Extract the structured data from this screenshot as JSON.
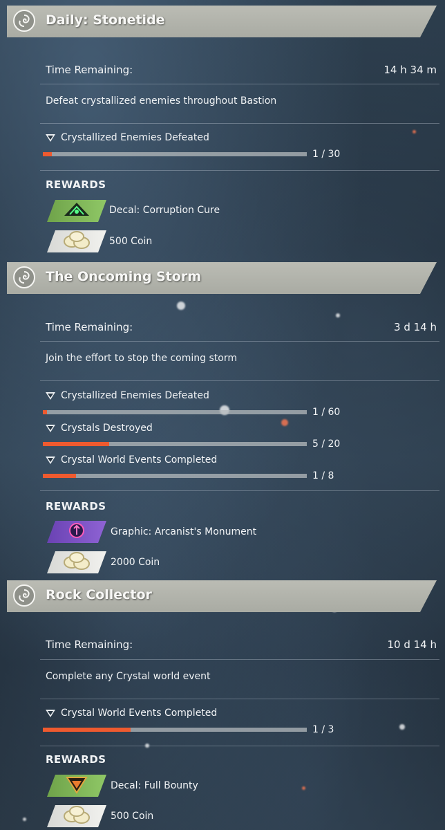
{
  "quests": [
    {
      "title": "Daily: Stonetide",
      "time_label": "Time Remaining:",
      "time_value": "14 h 34 m",
      "description": "Defeat crystallized enemies throughout Bastion",
      "objectives": [
        {
          "label": "Crystallized Enemies Defeated",
          "count": "1 / 30",
          "progress": 0.033
        }
      ],
      "rewards_heading": "REWARDS",
      "rewards": [
        {
          "label": "Decal: Corruption Cure",
          "icon": "decal-corruption-cure-icon",
          "chip_color": "#8fc766"
        },
        {
          "label": "500 Coin",
          "icon": "coins-icon",
          "chip_color": "#f1f1ee"
        }
      ]
    },
    {
      "title": "The Oncoming Storm",
      "time_label": "Time Remaining:",
      "time_value": "3 d 14 h",
      "description": "Join the effort to stop the coming storm",
      "objectives": [
        {
          "label": "Crystallized Enemies Defeated",
          "count": "1 / 60",
          "progress": 0.017
        },
        {
          "label": "Crystals Destroyed",
          "count": "5 / 20",
          "progress": 0.25
        },
        {
          "label": "Crystal World Events Completed",
          "count": "1 / 8",
          "progress": 0.125
        }
      ],
      "rewards_heading": "REWARDS",
      "rewards": [
        {
          "label": "Graphic: Arcanist's Monument",
          "icon": "graphic-arcanist-monument-icon",
          "chip_color": "#8e63d4"
        },
        {
          "label": "2000 Coin",
          "icon": "coins-icon",
          "chip_color": "#f1f1ee"
        }
      ]
    },
    {
      "title": "Rock Collector",
      "time_label": "Time Remaining:",
      "time_value": "10 d 14 h",
      "description": "Complete any Crystal world event",
      "objectives": [
        {
          "label": "Crystal World Events Completed",
          "count": "1 / 3",
          "progress": 0.333
        }
      ],
      "rewards_heading": "REWARDS",
      "rewards": [
        {
          "label": "Decal: Full Bounty",
          "icon": "decal-full-bounty-icon",
          "chip_color": "#8fc766"
        },
        {
          "label": "500 Coin",
          "icon": "coins-icon",
          "chip_color": "#f1f1ee"
        }
      ]
    }
  ],
  "colors": {
    "progress_fill": "#ef5a2f",
    "banner": "#b3b4ad"
  }
}
